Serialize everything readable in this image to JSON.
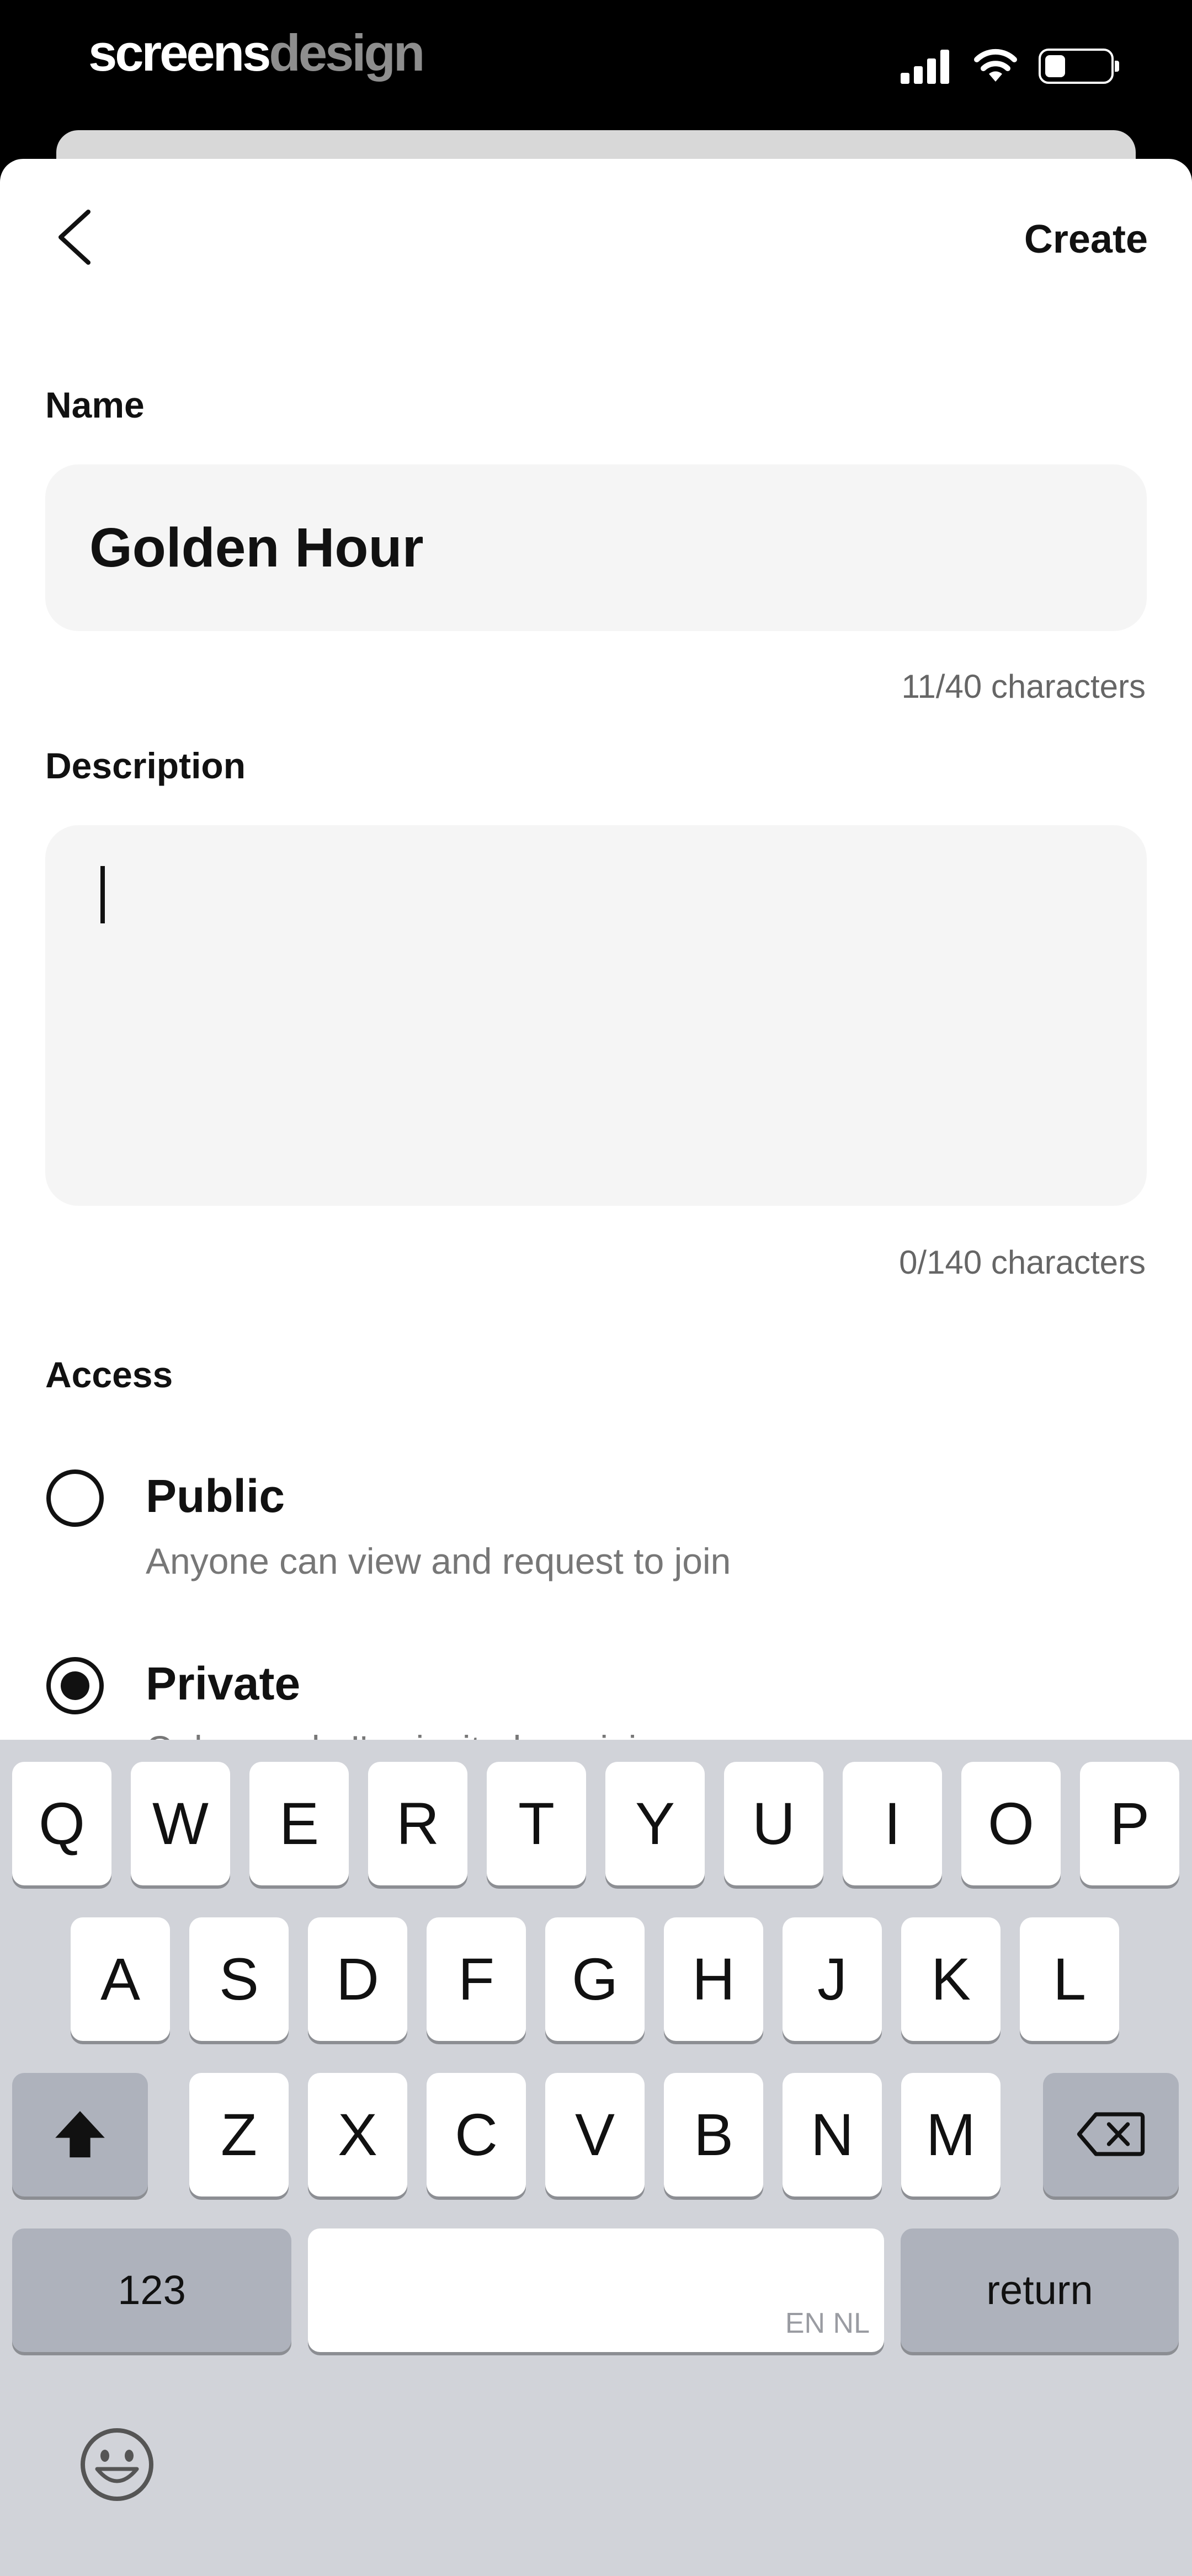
{
  "status_bar": {
    "brand_main": "screens",
    "brand_accent": "design"
  },
  "header": {
    "create_label": "Create"
  },
  "form": {
    "name_label": "Name",
    "name_value": "Golden Hour",
    "name_counter": "11/40 characters",
    "description_label": "Description",
    "description_value": "",
    "description_counter": "0/140 characters",
    "access_label": "Access",
    "options": [
      {
        "title": "Public",
        "subtitle": "Anyone can view and request to join",
        "selected": false
      },
      {
        "title": "Private",
        "subtitle": "Only people I've invited can join",
        "selected": true
      }
    ]
  },
  "keyboard": {
    "row1": [
      "Q",
      "W",
      "E",
      "R",
      "T",
      "Y",
      "U",
      "I",
      "O",
      "P"
    ],
    "row2": [
      "A",
      "S",
      "D",
      "F",
      "G",
      "H",
      "J",
      "K",
      "L"
    ],
    "row3": [
      "Z",
      "X",
      "C",
      "V",
      "B",
      "N",
      "M"
    ],
    "numbers_label": "123",
    "return_label": "return",
    "space_language": "EN NL"
  }
}
